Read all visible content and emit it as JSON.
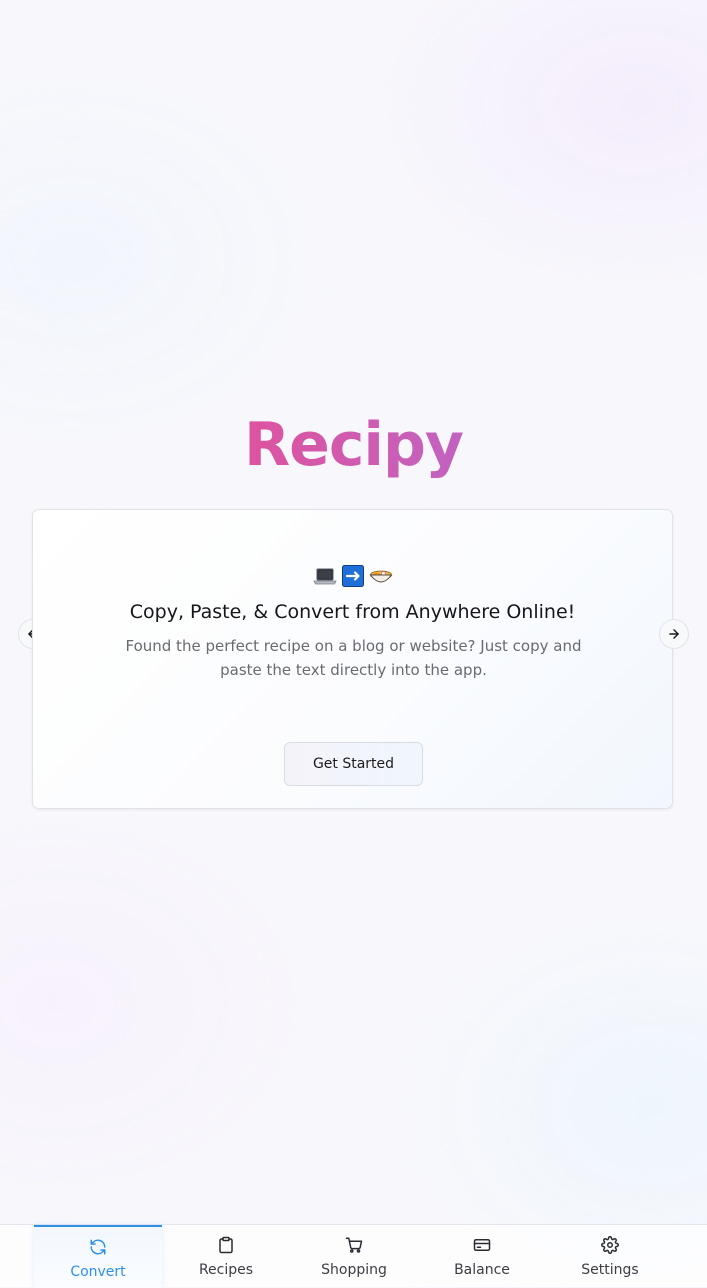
{
  "app": {
    "logo_text": "Recipy"
  },
  "onboarding_card": {
    "emojis": [
      "laptop-emoji",
      "right-arrow-emoji",
      "noodle-bowl-emoji"
    ],
    "title": "Copy, Paste, & Convert from Anywhere Online!",
    "description": "Found the perfect recipe on a blog or website? Just copy and paste the text directly into the app.",
    "cta_label": "Get Started"
  },
  "carousel": {
    "prev_icon": "arrow-left-icon",
    "next_icon": "arrow-right-icon"
  },
  "tabbar": {
    "active_color": "#2d8fe8",
    "tabs": [
      {
        "label": "Convert",
        "icon": "refresh-icon",
        "active": true
      },
      {
        "label": "Recipes",
        "icon": "clipboard-icon",
        "active": false
      },
      {
        "label": "Shopping",
        "icon": "cart-icon",
        "active": false
      },
      {
        "label": "Balance",
        "icon": "credit-card-icon",
        "active": false
      },
      {
        "label": "Settings",
        "icon": "gear-icon",
        "active": false
      }
    ]
  },
  "colors": {
    "logo_gradient": [
      "#ec4b8e",
      "#b36bd0"
    ]
  }
}
